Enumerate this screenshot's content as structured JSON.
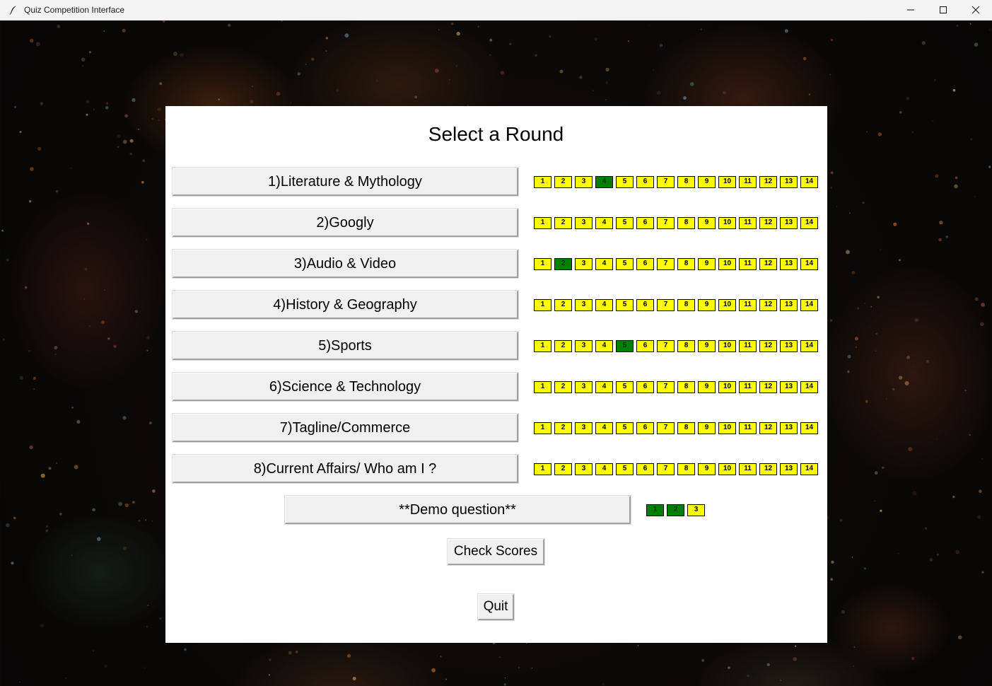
{
  "window": {
    "title": "Quiz Competition Interface",
    "controls": [
      "minimize-icon",
      "maximize-icon",
      "close-icon"
    ]
  },
  "main": {
    "title": "Select a Round",
    "rounds": [
      {
        "label": "1)Literature & Mythology",
        "questions": [
          "1",
          "2",
          "3",
          "4",
          "5",
          "6",
          "7",
          "8",
          "9",
          "10",
          "11",
          "12",
          "13",
          "14"
        ],
        "done": [
          4
        ]
      },
      {
        "label": "2)Googly",
        "questions": [
          "1",
          "2",
          "3",
          "4",
          "5",
          "6",
          "7",
          "8",
          "9",
          "10",
          "11",
          "12",
          "13",
          "14"
        ],
        "done": []
      },
      {
        "label": "3)Audio & Video",
        "questions": [
          "1",
          "2",
          "3",
          "4",
          "5",
          "6",
          "7",
          "8",
          "9",
          "10",
          "11",
          "12",
          "13",
          "14"
        ],
        "done": [
          2
        ]
      },
      {
        "label": "4)History & Geography",
        "questions": [
          "1",
          "2",
          "3",
          "4",
          "5",
          "6",
          "7",
          "8",
          "9",
          "10",
          "11",
          "12",
          "13",
          "14"
        ],
        "done": []
      },
      {
        "label": "5)Sports",
        "questions": [
          "1",
          "2",
          "3",
          "4",
          "5",
          "6",
          "7",
          "8",
          "9",
          "10",
          "11",
          "12",
          "13",
          "14"
        ],
        "done": [
          5
        ]
      },
      {
        "label": "6)Science & Technology",
        "questions": [
          "1",
          "2",
          "3",
          "4",
          "5",
          "6",
          "7",
          "8",
          "9",
          "10",
          "11",
          "12",
          "13",
          "14"
        ],
        "done": []
      },
      {
        "label": "7)Tagline/Commerce",
        "questions": [
          "1",
          "2",
          "3",
          "4",
          "5",
          "6",
          "7",
          "8",
          "9",
          "10",
          "11",
          "12",
          "13",
          "14"
        ],
        "done": []
      },
      {
        "label": "8)Current Affairs/ Who am I ?",
        "questions": [
          "1",
          "2",
          "3",
          "4",
          "5",
          "6",
          "7",
          "8",
          "9",
          "10",
          "11",
          "12",
          "13",
          "14"
        ],
        "done": []
      }
    ],
    "demo": {
      "label": "**Demo question**",
      "questions": [
        "1",
        "2",
        "3"
      ],
      "done": [
        1,
        2
      ]
    },
    "check_scores_label": "Check Scores",
    "quit_label": "Quit"
  },
  "colors": {
    "pending": "#ffff00",
    "done": "#008000",
    "panel": "#ffffff",
    "button_face": "#f0f0f0"
  }
}
